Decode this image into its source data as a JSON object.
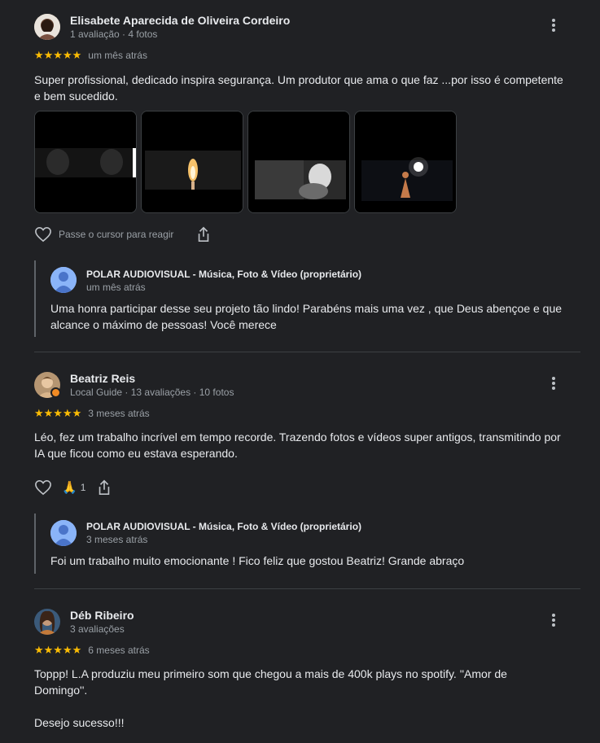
{
  "reviews": [
    {
      "author": "Elisabete Aparecida de Oliveira Cordeiro",
      "meta": "1 avaliação · 4 fotos",
      "stars": "★★★★★",
      "when": "um mês atrás",
      "text": "Super profissional, dedicado inspira segurança. Um produtor que ama o que faz ...por isso é competente e bem sucedido.",
      "react_hint": "Passe o cursor para reagir",
      "reply": {
        "author": "POLAR AUDIOVISUAL - Música, Foto & Vídeo (proprietário)",
        "when": "um mês atrás",
        "text": "Uma honra participar desse seu projeto tão lindo! Parabéns mais uma vez , que Deus abençoe e que alcance o máximo de pessoas! Você merece"
      }
    },
    {
      "author": "Beatriz Reis",
      "meta": "Local Guide · 13 avaliações · 10 fotos",
      "stars": "★★★★★",
      "when": "3 meses atrás",
      "text": "Léo, fez um trabalho incrível em tempo recorde. Trazendo fotos e vídeos super antigos, transmitindo por IA que ficou como eu estava esperando.",
      "reaction_emoji": "🙏",
      "reaction_count": "1",
      "reply": {
        "author": "POLAR AUDIOVISUAL - Música, Foto & Vídeo (proprietário)",
        "when": "3 meses atrás",
        "text": "Foi um trabalho muito emocionante ! Fico feliz que gostou Beatriz! Grande abraço"
      }
    },
    {
      "author": "Déb Ribeiro",
      "meta": "3 avaliações",
      "stars": "★★★★★",
      "when": "6 meses atrás",
      "text": "Toppp! L.A produziu meu primeiro som que chegou a mais de 400k plays no spotify. ''Amor de Domingo''.",
      "text2": "Desejo sucesso!!!"
    }
  ],
  "icons": {
    "more": "more-vert-icon",
    "heart": "heart-outline-icon",
    "share": "share-icon"
  },
  "colors": {
    "background": "#202124",
    "star": "#fbbc04",
    "muted": "#9aa0a6",
    "reply_avatar": "#8ab4f8"
  }
}
